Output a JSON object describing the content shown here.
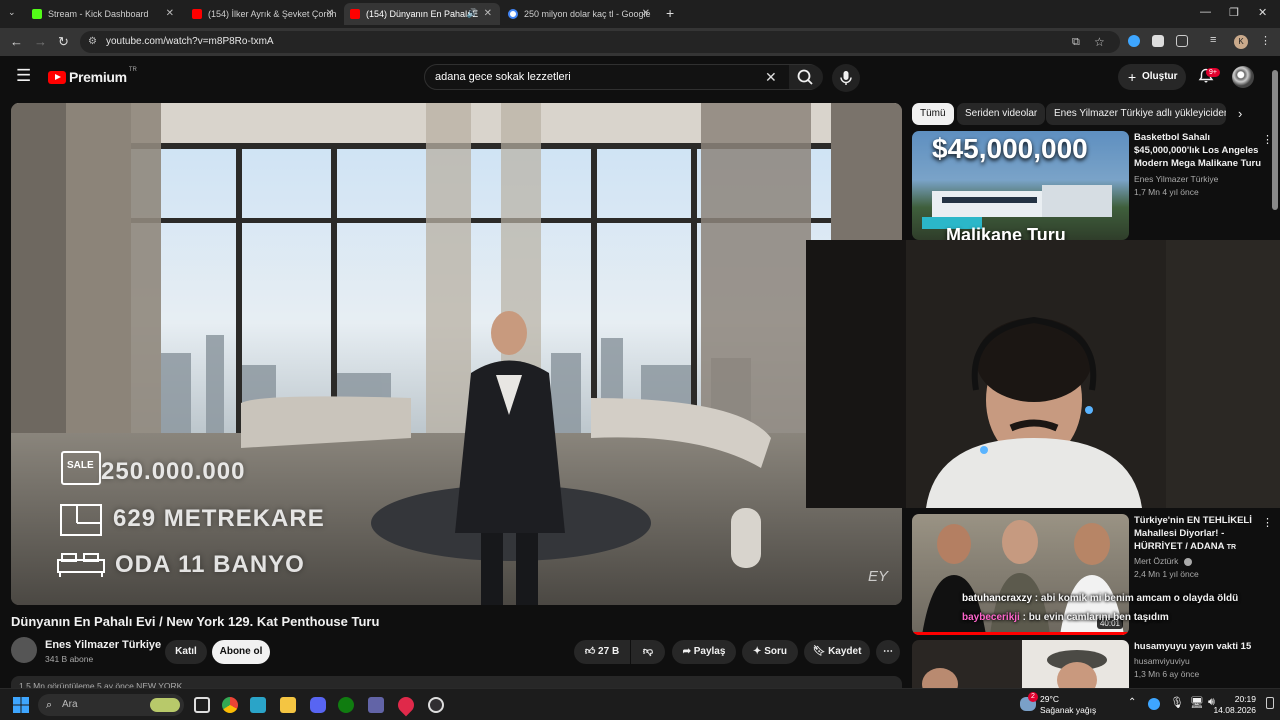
{
  "browser": {
    "tabs": [
      {
        "title": "Stream - Kick Dashboard",
        "favicon_color": "#53fc18"
      },
      {
        "title": "(154) İlker Ayrık & Şevket Çoruh",
        "favicon_color": "#ff0000"
      },
      {
        "title": "(154) Dünyanın En Pahalı Evi",
        "favicon_color": "#ff0000"
      },
      {
        "title": "250 milyon dolar kaç tl - Google",
        "favicon_color": "#4285f4"
      }
    ],
    "address": "youtube.com/watch?v=m8P8Ro-txmA",
    "profile_letter": "K"
  },
  "masthead": {
    "logo": "Premium",
    "logo_region": "TR",
    "search_query": "adana gece sokak lezzetleri",
    "create_label": "Oluştur",
    "notification_count": "9+"
  },
  "player": {
    "overlay": {
      "sale_badge": "SALE",
      "price": "250.000.000",
      "area": "629 METREKARE",
      "rooms": "ODA 11 BANYO",
      "watermark": "EY"
    }
  },
  "video": {
    "title": "Dünyanın En Pahalı Evi / New York 129. Kat Penthouse Turu",
    "channel": "Enes Yilmazer Türkiye",
    "subscribers": "341 B abone",
    "join_label": "Katıl",
    "subscribe_label": "Abone ol",
    "likes": "27 B",
    "share_label": "Paylaş",
    "ask_label": "Soru",
    "save_label": "Kaydet",
    "description_preview": "1,5 Mn görüntüleme  5 ay önce  NEW YORK"
  },
  "chips": [
    "Tümü",
    "Seriden videolar",
    "Enes Yilmazer Türkiye adlı yükleyiciden"
  ],
  "recommendations": [
    {
      "title": "Basketbol Sahalı $45,000,000'lık Los Angeles Modern Mega Malikane Turu",
      "channel": "Enes Yilmazer Türkiye",
      "meta": "1,7 Mn  4 yıl önce",
      "thumb_text": "$45,000,000",
      "thumb_text2": "Malikane Turu"
    },
    {
      "title": "Türkiye'nin EN TEHLİKELİ Mahallesi Diyorlar! - HÜRRİYET / ADANA",
      "title_suffix": "TR",
      "channel": "Mert Öztürk",
      "meta": "2,4 Mn  1 yıl önce",
      "duration": "40:01"
    },
    {
      "title": "husamyuyu yayın vakti 15",
      "channel": "husamviyuviyu",
      "meta": "1,3 Mn  6 ay önce"
    }
  ],
  "chat": [
    {
      "user": "batuhancraxzy",
      "user_color": "#ffffff",
      "text": "abi komik mi benim amcam o olayda öldü"
    },
    {
      "user": "baybecerikji",
      "user_color": "#ff66cc",
      "text": "bu evin camlarını ben taşıdım"
    }
  ],
  "taskbar": {
    "search_placeholder": "Ara",
    "weather_temp": "29°C",
    "weather_desc": "Sağanak yağış",
    "weather_badge": "2",
    "time": "20:19",
    "date": "14.08.2026"
  }
}
